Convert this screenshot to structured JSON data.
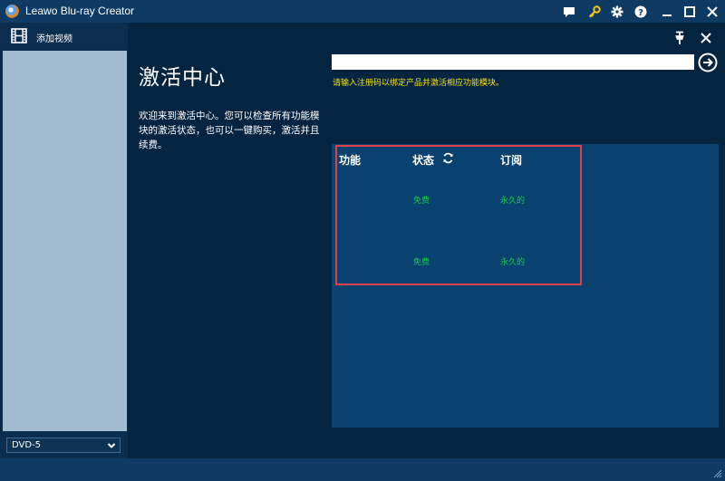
{
  "window": {
    "title": "Leawo Blu-ray Creator"
  },
  "sidebar": {
    "add_video_label": "添加视频",
    "disc_type": "DVD-5"
  },
  "activation": {
    "title": "激活中心",
    "description": "欢迎来到激活中心。您可以检查所有功能模块的激活状态，也可以一键购买，激活并且续费。",
    "input_value": "",
    "input_placeholder": "",
    "hint": "请输入注册码以绑定产品并激活相应功能模块。",
    "columns": {
      "feature": "功能",
      "status": "状态",
      "subscription": "订阅"
    },
    "rows": [
      {
        "feature": "",
        "status": "免费",
        "subscription": "永久的"
      },
      {
        "feature": "",
        "status": "免费",
        "subscription": "永久的"
      }
    ]
  },
  "colors": {
    "accent_hint": "#f2e21c",
    "status_green": "#18c84a",
    "highlight_red": "#e0404a",
    "titlebar": "#0e3a63",
    "main_bg": "#052440",
    "panel_bg": "#0a426f"
  },
  "icons": [
    "app-logo-icon",
    "chat-icon",
    "key-icon",
    "gear-icon",
    "help-icon",
    "minimize-icon",
    "maximize-icon",
    "close-icon",
    "film-icon",
    "pin-icon",
    "arrow-right-circle-icon",
    "refresh-icon",
    "chevron-down-icon"
  ]
}
